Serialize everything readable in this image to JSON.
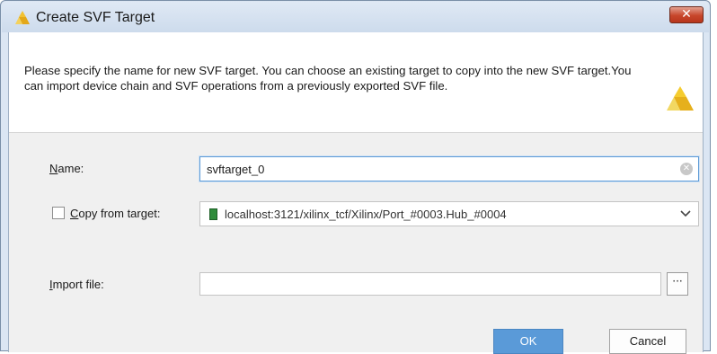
{
  "window": {
    "title": "Create SVF Target",
    "close_glyph": "✕",
    "icon": "xilinx-logo-icon"
  },
  "header": {
    "description": "Please specify the name for new SVF target. You can choose an existing target to copy into the new SVF target.You can import device chain and SVF operations from a previously exported SVF file.",
    "logo": "xilinx-logo-icon"
  },
  "form": {
    "name": {
      "label_mnemonic": "N",
      "label_rest": "ame:",
      "value": "svftarget_0"
    },
    "copy_from_target": {
      "checked": false,
      "label_mnemonic": "C",
      "label_rest": "opy from target:",
      "value": "localhost:3121/xilinx_tcf/Xilinx/Port_#0003.Hub_#0004"
    },
    "import_file": {
      "label_mnemonic": "I",
      "label_rest": "mport file:",
      "value": "",
      "browse_label": "···"
    }
  },
  "buttons": {
    "ok": "OK",
    "cancel": "Cancel"
  },
  "colors": {
    "accent": "#5a9ad8",
    "logo": "#e8b821",
    "close": "#c7462b"
  }
}
